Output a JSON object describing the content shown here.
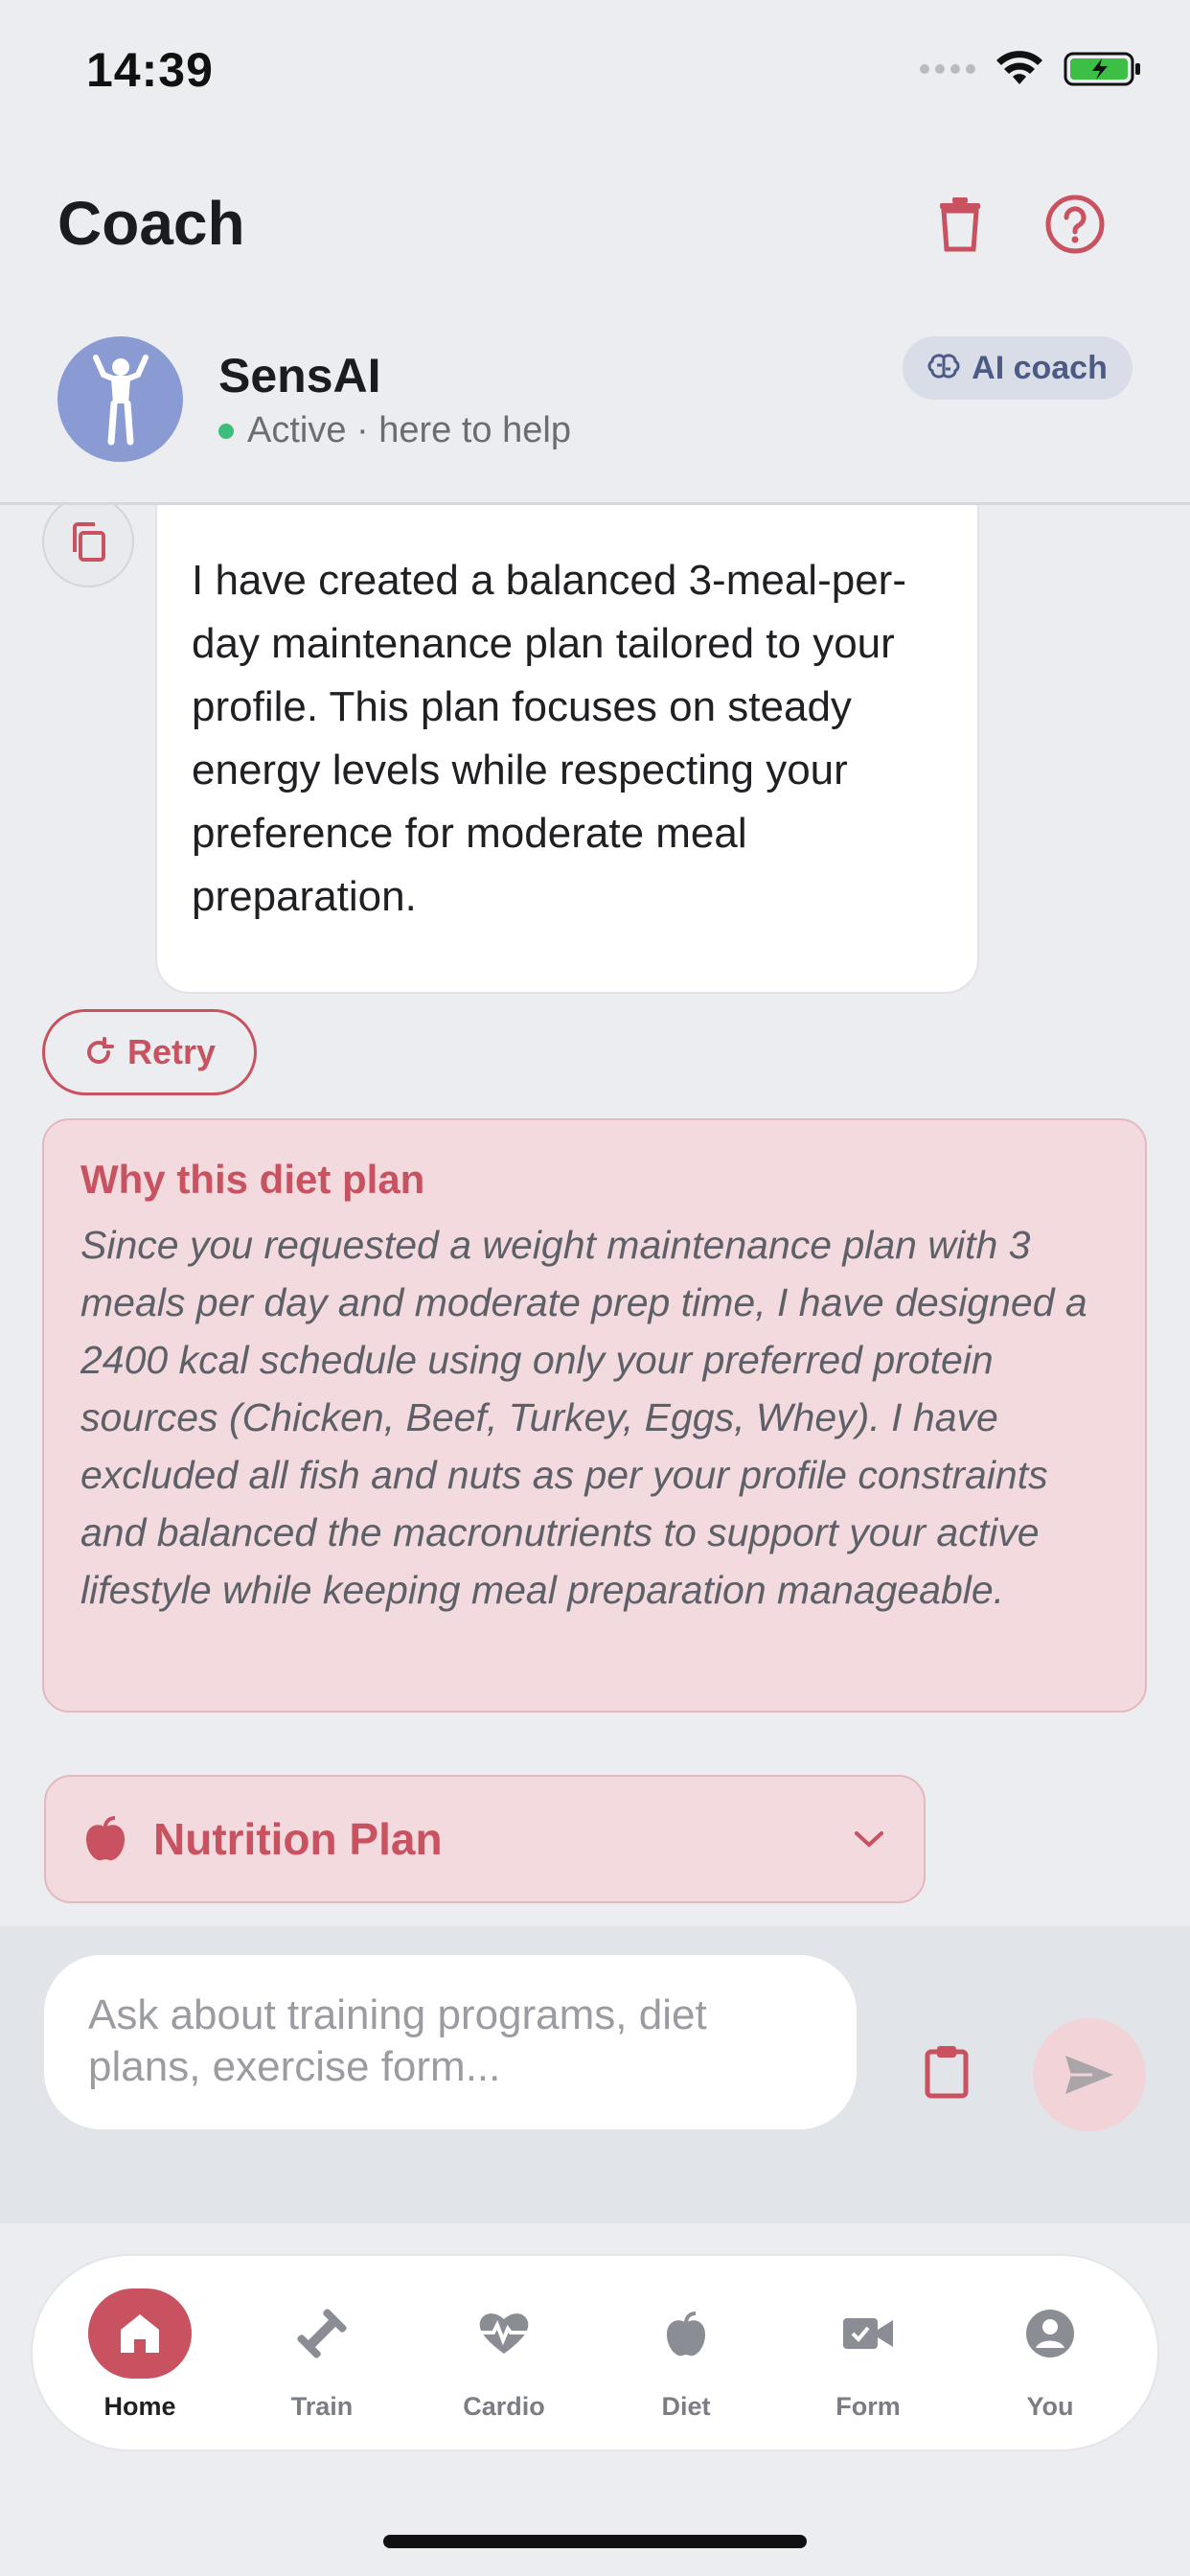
{
  "status_bar": {
    "time": "14:39"
  },
  "header": {
    "title": "Coach"
  },
  "coach": {
    "name": "SensAI",
    "status": "Active · here to help",
    "badge": "AI coach"
  },
  "chat": {
    "assistant_message": "I have created a balanced 3-meal-per-day maintenance plan tailored to your profile. This plan focuses on steady energy levels while respecting your preference for moderate meal preparation.",
    "retry_label": "Retry",
    "why_card": {
      "title": "Why this diet plan",
      "body": "Since you requested a weight maintenance plan with 3 meals per day and moderate prep time, I have designed a 2400 kcal schedule using only your preferred protein sources (Chicken, Beef, Turkey, Eggs, Whey). I have excluded all fish and nuts as per your profile constraints and balanced the macronutrients to support your active lifestyle while keeping meal preparation manageable."
    },
    "nutrition_plan_label": "Nutrition Plan"
  },
  "composer": {
    "value": "",
    "placeholder": "Ask about training programs, diet plans, exercise form..."
  },
  "tabs": [
    {
      "label": "Home",
      "icon": "home-icon",
      "active": true
    },
    {
      "label": "Train",
      "icon": "dumbbell-icon",
      "active": false
    },
    {
      "label": "Cardio",
      "icon": "heartbeat-icon",
      "active": false
    },
    {
      "label": "Diet",
      "icon": "apple-icon",
      "active": false
    },
    {
      "label": "Form",
      "icon": "video-camera-icon",
      "active": false
    },
    {
      "label": "You",
      "icon": "user-circle-icon",
      "active": false
    }
  ],
  "colors": {
    "accent": "#C8525F",
    "background": "#EBEDF1",
    "card_tint": "#F2DADF",
    "online": "#3DBE7A",
    "avatar": "#8A9BD3"
  }
}
